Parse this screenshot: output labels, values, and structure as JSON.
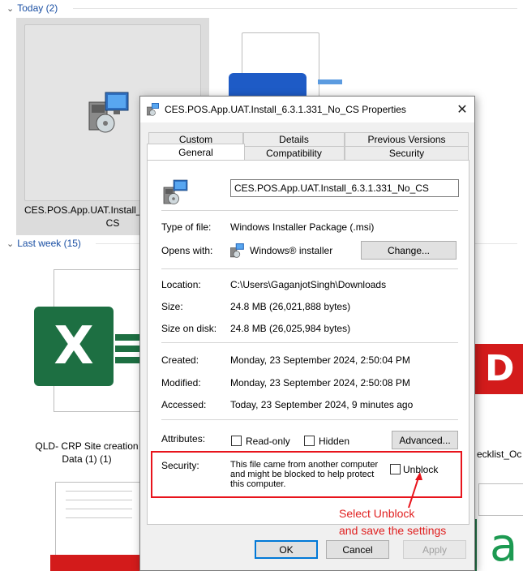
{
  "explorer": {
    "groups": [
      {
        "label": "Today (2)"
      },
      {
        "label": "Last week (15)"
      }
    ],
    "items": [
      {
        "caption_line1": "CES.POS.App.UAT.Install_6",
        "caption_line2": "CS",
        "icon": "installer-package-icon"
      },
      {
        "caption_line1": "QLD- CRP Site creation",
        "caption_line2": "Data (1) (1)",
        "icon": "excel-file-icon"
      },
      {
        "caption_line1": "ecklist_Oc",
        "icon": "pdf-file-icon"
      },
      {
        "icon": "word-file-icon"
      }
    ]
  },
  "dialog": {
    "title": "CES.POS.App.UAT.Install_6.3.1.331_No_CS Properties",
    "close_glyph": "✕",
    "tabs_back": [
      "Custom",
      "Details",
      "Previous Versions"
    ],
    "tabs_front": [
      "General",
      "Compatibility",
      "Security"
    ],
    "active_tab": "General",
    "filename": "CES.POS.App.UAT.Install_6.3.1.331_No_CS",
    "labels": {
      "type": "Type of file:",
      "opens": "Opens with:",
      "location": "Location:",
      "size": "Size:",
      "size_on_disk": "Size on disk:",
      "created": "Created:",
      "modified": "Modified:",
      "accessed": "Accessed:",
      "attributes": "Attributes:",
      "security": "Security:"
    },
    "values": {
      "type": "Windows Installer Package (.msi)",
      "opens": "Windows® installer",
      "location": "C:\\Users\\GaganjotSingh\\Downloads",
      "size": "24.8 MB (26,021,888 bytes)",
      "size_on_disk": "24.8 MB (26,025,984 bytes)",
      "created": "Monday, 23 September 2024, 2:50:04 PM",
      "modified": "Monday, 23 September 2024, 2:50:08 PM",
      "accessed": "Today, 23 September 2024, 9 minutes ago",
      "security_line1": "This file came from another computer",
      "security_line2": "and might be blocked to help protect",
      "security_line3": "this computer."
    },
    "buttons": {
      "change": "Change...",
      "advanced": "Advanced...",
      "ok": "OK",
      "cancel": "Cancel",
      "apply": "Apply"
    },
    "checkboxes": {
      "readonly": {
        "label": "Read-only",
        "checked": false
      },
      "hidden": {
        "label": "Hidden",
        "checked": false
      },
      "unblock": {
        "label": "Unblock",
        "checked": false
      }
    }
  },
  "annotation": {
    "line1": "Select Unblock",
    "line2": "and save the settings",
    "color": "#e02020"
  }
}
